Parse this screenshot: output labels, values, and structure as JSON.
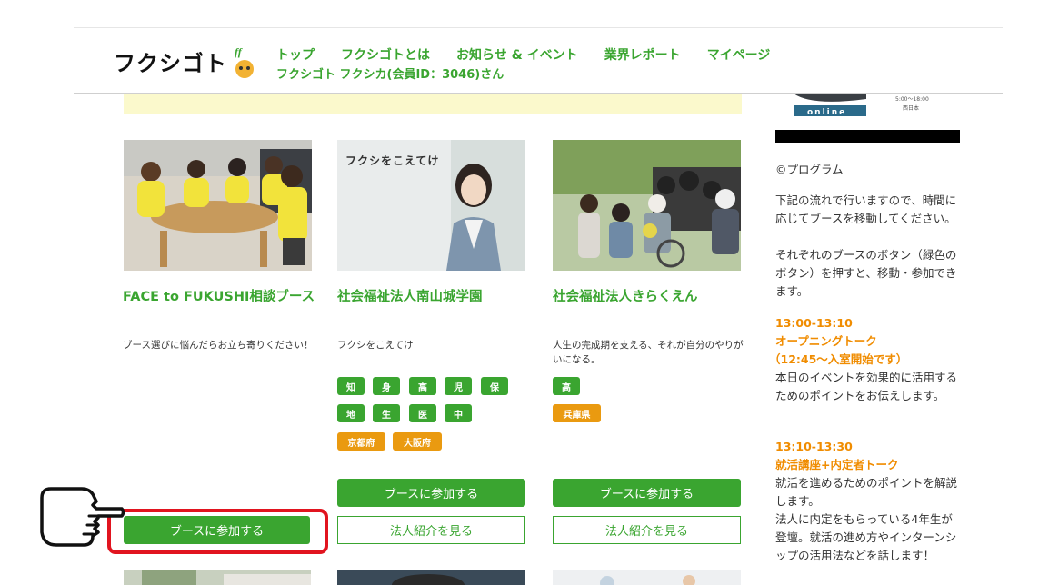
{
  "header": {
    "logo_text": "フクシゴト",
    "logo_badge": "ff",
    "nav": [
      "トップ",
      "フクシゴトとは",
      "お知らせ & イベント",
      "業界レポート",
      "マイページ"
    ],
    "member_text": "フクシゴト フクシカ(会員ID：3046)さん"
  },
  "cards": [
    {
      "title": "FACE to FUKUSHI相談ブース",
      "desc": "ブース選びに悩んだらお立ち寄りください！",
      "join_label": "ブースに参加する"
    },
    {
      "photo_caption": "フクシをこえてけ",
      "title": "社会福祉法人南山城学園",
      "desc": "フクシをこえてけ",
      "tags_green": [
        "知",
        "身",
        "高",
        "児",
        "保",
        "地",
        "生",
        "医",
        "中"
      ],
      "tags_orange": [
        "京都府",
        "大阪府"
      ],
      "join_label": "ブースに参加する",
      "intro_label": "法人紹介を見る"
    },
    {
      "title": "社会福祉法人きらくえん",
      "desc": "人生の完成期を支える、それが自分のやりがいになる。",
      "tags_green": [
        "高"
      ],
      "tags_orange": [
        "兵庫県"
      ],
      "join_label": "ブースに参加する",
      "intro_label": "法人紹介を見る"
    }
  ],
  "sidebar": {
    "banner_online": "online",
    "banner_time": "5:00〜18:00",
    "banner_region": "西日本",
    "program_heading": "©プログラム",
    "intro": "下記の流れで行いますので、時間に応じてブースを移動してください。",
    "intro2": "それぞれのブースのボタン（緑色のボタン）を押すと、移動・参加できます。",
    "s1_time": "13:00-13:10",
    "s1_title": "オープニングトーク",
    "s1_note": "（12:45〜入室開始です）",
    "s1_desc": "本日のイベントを効果的に活用するためのポイントをお伝えします。",
    "s2_time": "13:10-13:30",
    "s2_title": "就活講座+内定者トーク",
    "s2_desc": "就活を進めるためのポイントを解説します。",
    "s2_desc2": "法人に内定をもらっている4年生が登壇。就活の進め方やインターンシップの活用法などを話します！"
  },
  "colors": {
    "accent_green": "#3aa530",
    "accent_orange": "#f08c00",
    "highlight_red": "#e1141f"
  }
}
